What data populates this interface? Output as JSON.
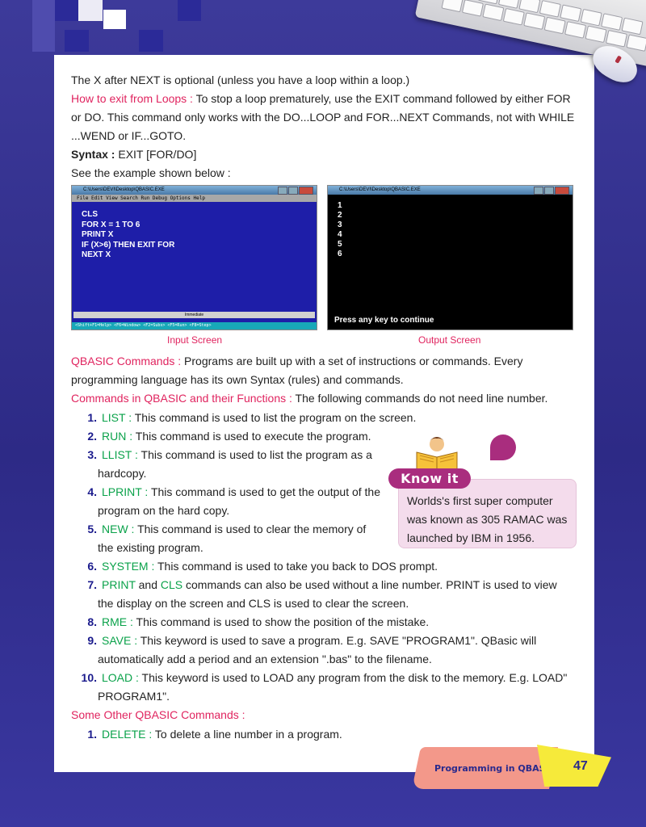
{
  "intro_line": "The X after NEXT is optional (unless you have a loop within a loop.)",
  "exit_loops": {
    "heading": "How to exit from Loops :",
    "body": " To stop a loop prematurely, use the EXIT command followed by either FOR or DO. This command only works with the DO...LOOP and FOR...NEXT Commands, not with WHILE ...WEND or IF...GOTO."
  },
  "syntax": {
    "label": "Syntax :",
    "value": " EXIT [FOR/DO]"
  },
  "example_line": "See the example shown below :",
  "input_screen": {
    "window_title": "C:\\Users\\DEVI\\Desktop\\QBASIC.EXE",
    "menu": "File  Edit  View  Search  Run  Debug  Options                    Help",
    "code": "CLS\nFOR X = 1 TO 6\nPRINT X\nIF (X>6) THEN EXIT FOR\nNEXT X",
    "immediate": "Immediate",
    "status": "<Shift+F1=Help> <F6=Window> <F2=Subs> <F5=Run> <F8=Step>"
  },
  "output_screen": {
    "window_title": "C:\\Users\\DEVI\\Desktop\\QBASIC.EXE",
    "numbers": "1\n2\n3\n4\n5\n6",
    "message": "Press any key to continue"
  },
  "captions": {
    "input": "Input Screen",
    "output": "Output Screen"
  },
  "qbasic_commands": {
    "heading": "QBASIC Commands :",
    "body": " Programs are built up with a set of instructions or commands. Every programming language has its own Syntax (rules) and commands."
  },
  "functions": {
    "heading": "Commands in QBASIC and their Functions :",
    "body": " The following commands do not need line number."
  },
  "commands": [
    {
      "n": "1.",
      "name": "LIST :",
      "desc": " This command is used to list the program on the screen."
    },
    {
      "n": "2.",
      "name": "RUN :",
      "desc": " This command is used to execute the program."
    },
    {
      "n": "3.",
      "name": "LLIST :",
      "desc": " This command is used to list the program as a",
      "desc2": "hardcopy."
    },
    {
      "n": "4.",
      "name": "LPRINT :",
      "desc": " This command is used to get the output of the",
      "desc2": "program on the hard copy."
    },
    {
      "n": "5.",
      "name": "NEW :",
      "desc": " This command is used to clear the memory of",
      "desc2": "the existing program."
    },
    {
      "n": "6.",
      "name": "SYSTEM :",
      "desc": " This command is used to take you back to DOS prompt."
    },
    {
      "n": "7.",
      "name": "PRINT",
      "mid": " and ",
      "name2": "CLS",
      "desc": " commands can also be used without a line number. PRINT is used to view",
      "desc2": "the display on the screen and CLS is used to clear the screen."
    },
    {
      "n": "8.",
      "name": "RME :",
      "desc": " This command is used to show the position of the mistake."
    },
    {
      "n": "9.",
      "name": "SAVE :",
      "desc": " This keyword is used to save a program. E.g. SAVE \"PROGRAM1\". QBasic will",
      "desc2": "automatically add a period and an extension \".bas\" to the filename."
    },
    {
      "n": "10.",
      "name": "LOAD :",
      "desc": " This keyword is used to LOAD any program from the disk to the memory. E.g. LOAD\"",
      "desc2": "PROGRAM1\"."
    }
  ],
  "other": {
    "heading": "Some Other QBASIC Commands :",
    "items": [
      {
        "n": "1.",
        "name": "DELETE :",
        "desc": " To delete a line number in a program."
      }
    ]
  },
  "know_it": {
    "label": "Know it",
    "text": "Worlds's first super computer was known as 305 RAMAC was launched by IBM in 1956."
  },
  "footer": {
    "section": "Programming in QBASIC",
    "page": "47"
  },
  "colors": {
    "accent_pink": "#e0245f",
    "accent_green": "#0aa24a",
    "band_blue": "#2d2a86",
    "know_purple": "#a92d7e"
  }
}
